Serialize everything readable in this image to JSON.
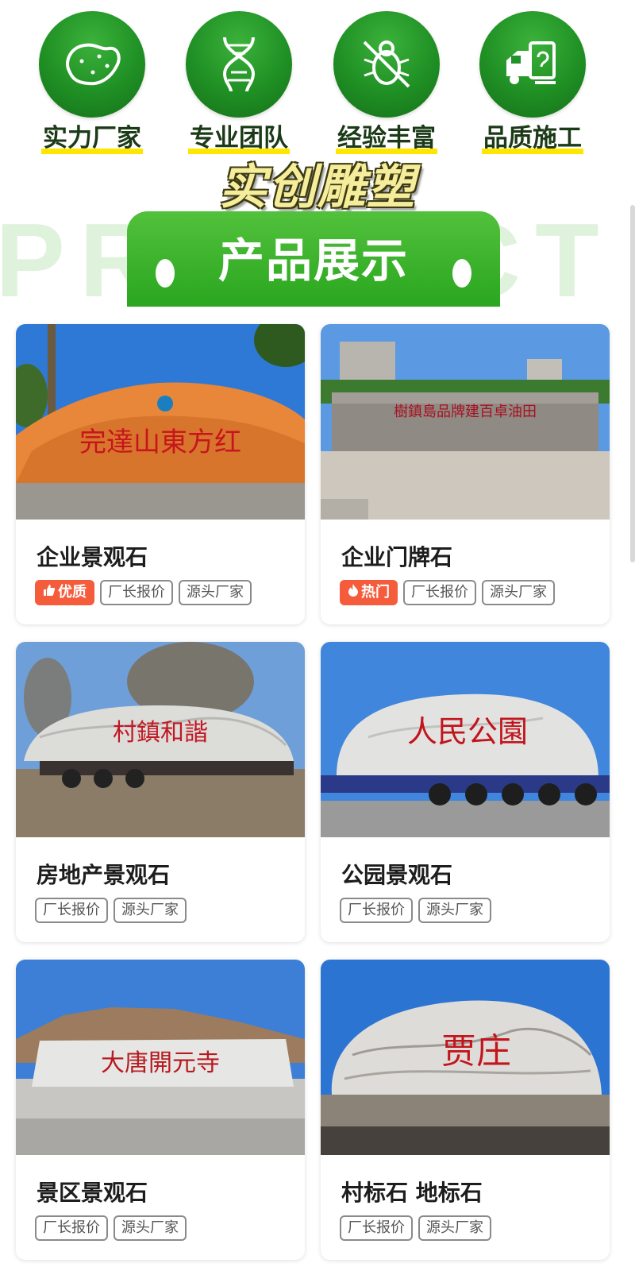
{
  "features": [
    {
      "label": "实力厂家",
      "icon": "potato-icon"
    },
    {
      "label": "专业团队",
      "icon": "dna-icon"
    },
    {
      "label": "经验丰富",
      "icon": "bug-block-icon"
    },
    {
      "label": "品质施工",
      "icon": "truck-icon"
    }
  ],
  "brand_title": "实创雕塑",
  "section": {
    "watermark": "PRODUCT",
    "title": "产品展示"
  },
  "products": [
    {
      "name": "企业景观石",
      "badge": "优质",
      "badge_icon": "thumbs-up-icon",
      "tags": [
        "厂长报价",
        "源头厂家"
      ],
      "photo_text": "完達山東方红"
    },
    {
      "name": "企业门牌石",
      "badge": "热门",
      "badge_icon": "flame-icon",
      "tags": [
        "厂长报价",
        "源头厂家"
      ],
      "photo_text": "樹鎮島品牌建百卓油田"
    },
    {
      "name": "房地产景观石",
      "badge": "",
      "tags": [
        "厂长报价",
        "源头厂家"
      ],
      "photo_text": "村鎮和諧"
    },
    {
      "name": "公园景观石",
      "badge": "",
      "tags": [
        "厂长报价",
        "源头厂家"
      ],
      "photo_text": "人民公園"
    },
    {
      "name": "景区景观石",
      "badge": "",
      "tags": [
        "厂长报价",
        "源头厂家"
      ],
      "photo_text": "大唐開元寺"
    },
    {
      "name": "村标石 地标石",
      "badge": "",
      "tags": [
        "厂长报价",
        "源头厂家"
      ],
      "photo_text": "贾庄"
    }
  ],
  "colors": {
    "brand_green": "#2aa61f",
    "badge_red": "#f45c3c",
    "highlight_yellow": "#ffe600"
  }
}
